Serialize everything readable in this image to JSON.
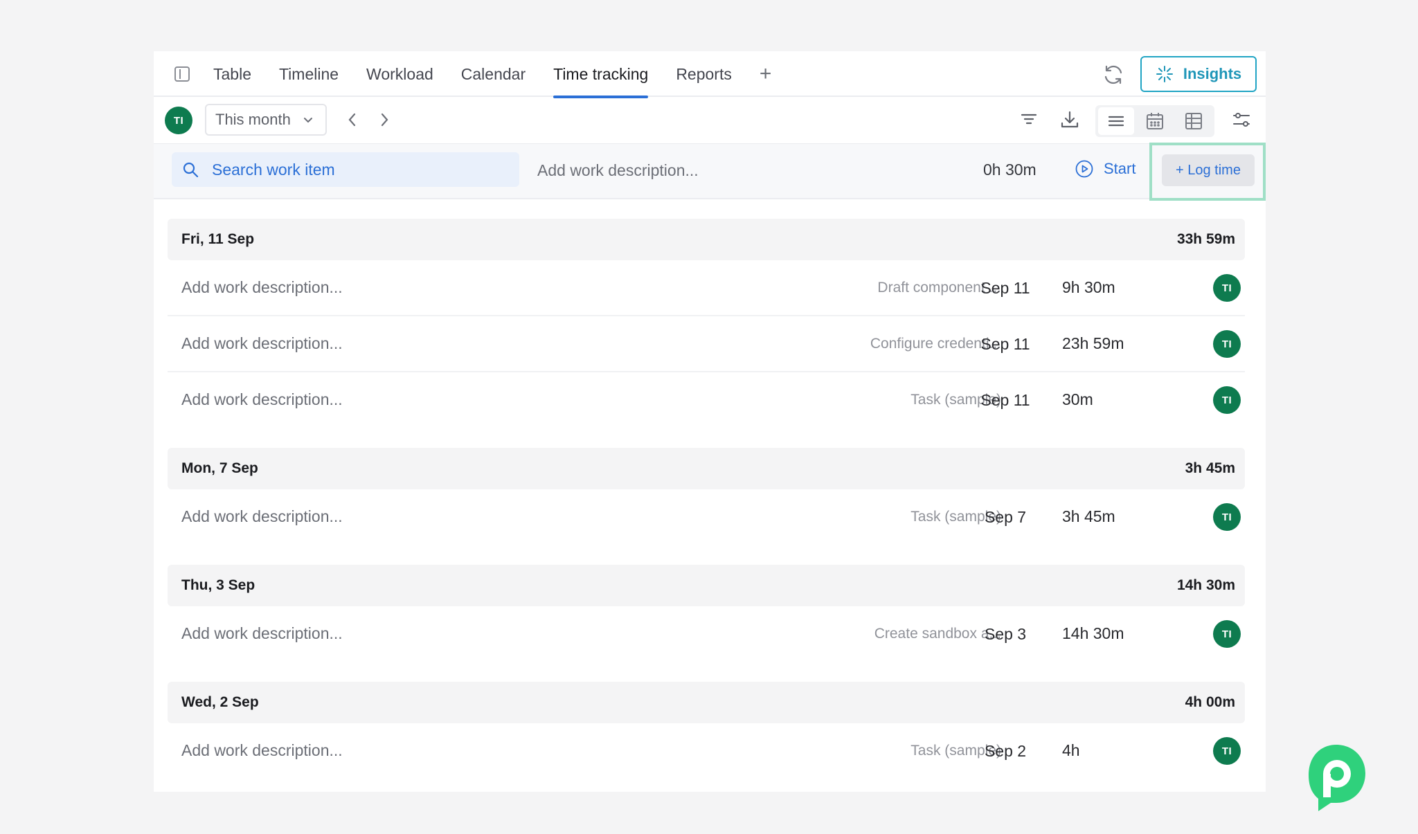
{
  "tabs": [
    {
      "label": "Table",
      "active": false
    },
    {
      "label": "Timeline",
      "active": false
    },
    {
      "label": "Workload",
      "active": false
    },
    {
      "label": "Calendar",
      "active": false
    },
    {
      "label": "Time tracking",
      "active": true
    },
    {
      "label": "Reports",
      "active": false
    }
  ],
  "add_tab_label": "+",
  "insights_label": "Insights",
  "toolbar": {
    "user_initials": "TI",
    "period": "This month"
  },
  "entry": {
    "search_placeholder": "Search work item",
    "description_placeholder": "Add work description...",
    "duration": "0h 30m",
    "start_label": "Start",
    "log_time_label": "+ Log time"
  },
  "groups": [
    {
      "date": "Fri, 11 Sep",
      "total": "33h 59m",
      "rows": [
        {
          "description": "Add work description...",
          "item": "Draft component ...",
          "date": "Sep 11",
          "duration": "9h 30m",
          "user": "TI"
        },
        {
          "description": "Add work description...",
          "item": "Configure credenti...",
          "date": "Sep 11",
          "duration": "23h 59m",
          "user": "TI"
        },
        {
          "description": "Add work description...",
          "item": "Task (sample)",
          "date": "Sep 11",
          "duration": "30m",
          "user": "TI"
        }
      ]
    },
    {
      "date": "Mon, 7 Sep",
      "total": "3h 45m",
      "rows": [
        {
          "description": "Add work description...",
          "item": "Task (sample)",
          "date": "Sep 7",
          "duration": "3h 45m",
          "user": "TI"
        }
      ]
    },
    {
      "date": "Thu, 3 Sep",
      "total": "14h 30m",
      "rows": [
        {
          "description": "Add work description...",
          "item": "Create sandbox a...",
          "date": "Sep 3",
          "duration": "14h 30m",
          "user": "TI"
        }
      ]
    },
    {
      "date": "Wed, 2 Sep",
      "total": "4h 00m",
      "rows": [
        {
          "description": "Add work description...",
          "item": "Task (sample)",
          "date": "Sep 2",
          "duration": "4h",
          "user": "TI"
        }
      ]
    }
  ],
  "colors": {
    "accent": "#2b6fd6",
    "insights": "#1f96b8",
    "avatar": "#0e7b4f",
    "highlight": "#9fdfc6",
    "brand": "#2fd17c"
  }
}
